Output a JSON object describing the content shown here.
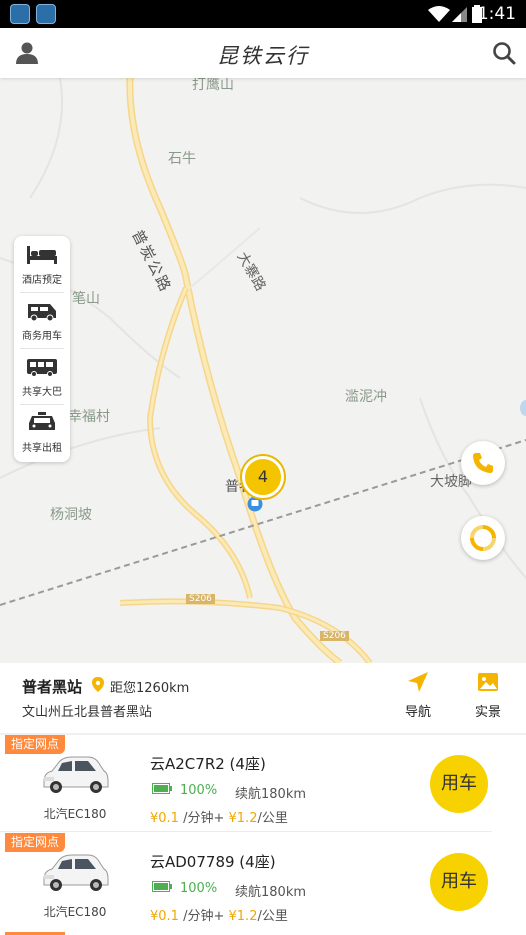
{
  "status_bar": {
    "time": "1:41"
  },
  "header": {
    "title": "昆铁云行",
    "profile_icon": "person-icon",
    "search_icon": "search-icon"
  },
  "map": {
    "labels": {
      "dayingshan": "打鹰山",
      "shiniu": "石牛",
      "puyan_road": "普炭公路",
      "daxiaolu": "大寨路",
      "bishan": "笔山",
      "xingfucun": "幸福村",
      "lanpichong": "滥泥冲",
      "dapo": "大坡脚",
      "yangdongpo": "杨洞坡",
      "puzhe": "普者",
      "s206_a": "S206",
      "s206_b": "S206"
    },
    "cluster_count": "4",
    "side_menu": [
      {
        "label": "酒店预定",
        "icon": "bed-icon"
      },
      {
        "label": "商务用车",
        "icon": "van-icon"
      },
      {
        "label": "共享大巴",
        "icon": "bus-icon"
      },
      {
        "label": "共享出租",
        "icon": "taxi-icon"
      }
    ],
    "buttons": {
      "phone_icon": "phone-icon",
      "locate_icon": "refresh-locate-icon"
    }
  },
  "station": {
    "name": "普者黑站",
    "distance": "距您1260km",
    "address": "文山州丘北县普者黑站",
    "nav_label": "导航",
    "scene_label": "实景"
  },
  "cars": [
    {
      "tag": "指定网点",
      "model": "北汽EC180",
      "plate": "云A2C7R2 (4座)",
      "battery": "100%",
      "battery_level": 1.0,
      "range": "续航180km",
      "price_min": "¥0.1",
      "price_min_unit": "/分钟+",
      "price_km": "¥1.2",
      "price_km_unit": "/公里",
      "button": "用车"
    },
    {
      "tag": "指定网点",
      "model": "北汽EC180",
      "plate": "云AD07789 (4座)",
      "battery": "100%",
      "battery_level": 1.0,
      "range": "续航180km",
      "price_min": "¥0.1",
      "price_min_unit": "/分钟+",
      "price_km": "¥1.2",
      "price_km_unit": "/公里",
      "button": "用车"
    }
  ],
  "colors": {
    "accent": "#f7d200",
    "tag": "#ff8a3d",
    "battery": "#4caf50",
    "price": "#f0a800"
  }
}
